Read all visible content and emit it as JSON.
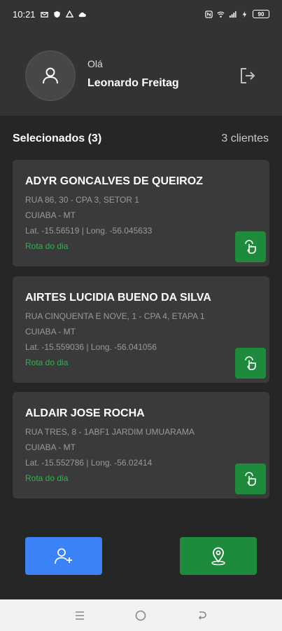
{
  "status_bar": {
    "time": "10:21",
    "left_icons": [
      "mail-icon",
      "shield-icon",
      "drive-icon",
      "cloud-icon"
    ],
    "right_icons": [
      "nfc-icon",
      "wifi-icon",
      "signal-icon",
      "charging-icon"
    ],
    "battery": "90"
  },
  "header": {
    "greeting": "Olá",
    "username": "Leonardo Freitag"
  },
  "section": {
    "title": "Selecionados (3)",
    "count": "3 clientes"
  },
  "clients": [
    {
      "name": "ADYR GONCALVES DE QUEIROZ",
      "address": "RUA 86, 30 - CPA 3, SETOR 1",
      "city": "CUIABA  - MT",
      "coords": "Lat. -15.56519 | Long. -56.045633",
      "route": "Rota do dia"
    },
    {
      "name": "AIRTES LUCIDIA BUENO DA SILVA",
      "address": "RUA CINQUENTA E NOVE, 1 - CPA 4, ETAPA 1",
      "city": "CUIABA  - MT",
      "coords": "Lat. -15.559036 | Long. -56.041056",
      "route": "Rota do dia"
    },
    {
      "name": "ALDAIR JOSE ROCHA",
      "address": "RUA TRES, 8 - 1ABF1 JARDIM UMUARAMA",
      "city": "CUIABA  - MT",
      "coords": "Lat. -15.552786 | Long. -56.02414",
      "route": "Rota do dia"
    }
  ],
  "colors": {
    "background": "#262626",
    "header": "#333333",
    "card": "#3a3a3a",
    "green": "#1e8a3c",
    "route_green": "#2fb34f",
    "blue": "#3b82f6"
  }
}
